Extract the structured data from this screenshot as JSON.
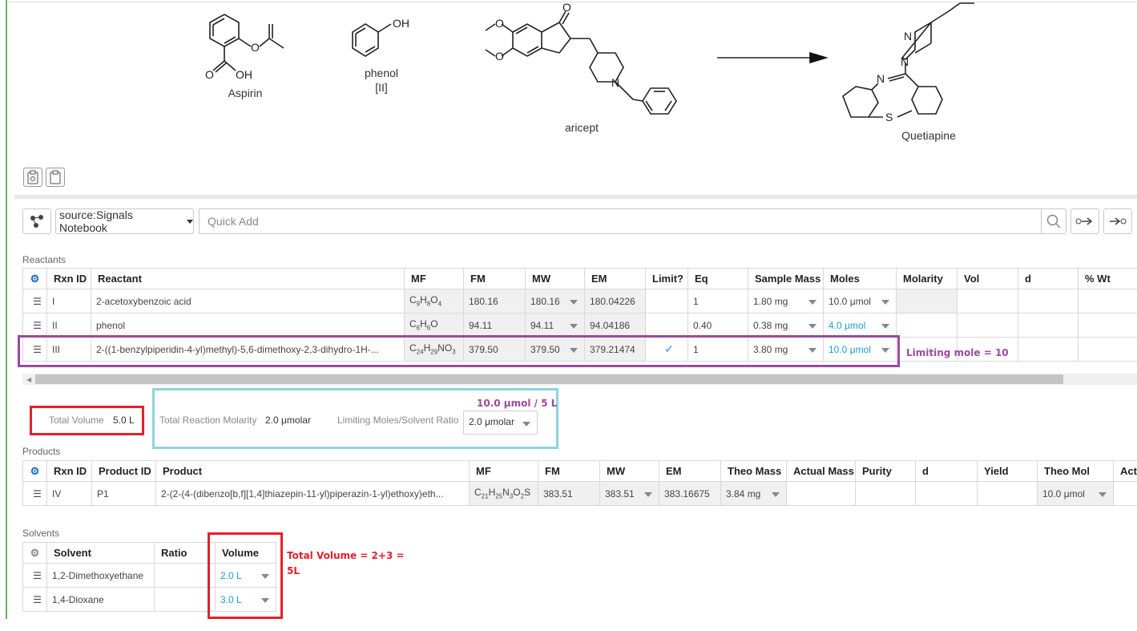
{
  "scheme": {
    "molecules": [
      {
        "label": "Aspirin",
        "atoms": [
          "O",
          "OH",
          "O"
        ]
      },
      {
        "label": "phenol",
        "sublabel": "[II]",
        "atoms": [
          "OH"
        ]
      },
      {
        "label": "aricept",
        "atoms": [
          "O",
          "N"
        ]
      },
      {
        "label": "Quetiapine",
        "atoms": [
          "N",
          "N",
          "N",
          "S"
        ]
      }
    ]
  },
  "toolbar": {
    "source_label": "source:Signals Notebook",
    "quick_add_placeholder": "Quick Add"
  },
  "reactants": {
    "section_label": "Reactants",
    "columns": [
      "Rxn ID",
      "Reactant",
      "MF",
      "FM",
      "MW",
      "EM",
      "Limit?",
      "Eq",
      "Sample Mass",
      "Moles",
      "Molarity",
      "Vol",
      "d",
      "% Wt"
    ],
    "rows": [
      {
        "rxn_id": "I",
        "reactant": "2-acetoxybenzoic acid",
        "mf": [
          "C",
          "9",
          "H",
          "8",
          "O",
          "4"
        ],
        "fm": "180.16",
        "mw": "180.16",
        "em": "180.04226",
        "limit": "",
        "eq": "1",
        "sample_mass": "1.80 mg",
        "moles": "10.0 μmol"
      },
      {
        "rxn_id": "II",
        "reactant": "phenol",
        "mf": [
          "C",
          "6",
          "H",
          "6",
          "O",
          ""
        ],
        "fm": "94.11",
        "mw": "94.11",
        "em": "94.04186",
        "limit": "",
        "eq": "0.40",
        "sample_mass": "0.38 mg",
        "moles": "4.0 μmol"
      },
      {
        "rxn_id": "III",
        "reactant": "2-((1-benzylpiperidin-4-yl)methyl)-5,6-dimethoxy-2,3-dihydro-1H-...",
        "mf": [
          "C",
          "24",
          "H",
          "29",
          "NO",
          "3"
        ],
        "fm": "379.50",
        "mw": "379.50",
        "em": "379.21474",
        "limit": "✓",
        "eq": "1",
        "sample_mass": "3.80 mg",
        "moles": "10.0 μmol"
      }
    ]
  },
  "summary": {
    "total_volume_label": "Total Volume",
    "total_volume_value": "5.0 L",
    "total_molarity_label": "Total Reaction Molarity",
    "total_molarity_value": "2.0 μmolar",
    "limiting_ratio_label": "Limiting Moles/Solvent Ratio",
    "limiting_ratio_value": "2.0 μmolar"
  },
  "products": {
    "section_label": "Products",
    "columns": [
      "Rxn ID",
      "Product ID",
      "Product",
      "MF",
      "FM",
      "MW",
      "EM",
      "Theo Mass",
      "Actual Mass",
      "Purity",
      "d",
      "Yield",
      "Theo Mol",
      "Actu"
    ],
    "rows": [
      {
        "rxn_id": "IV",
        "product_id": "P1",
        "product": "2-(2-(4-(dibenzo[b,f][1,4]thiazepin-11-yl)piperazin-1-yl)ethoxy)eth...",
        "mf": [
          "C",
          "21",
          "H",
          "25",
          "N",
          "3",
          "O",
          "2",
          "S",
          ""
        ],
        "fm": "383.51",
        "mw": "383.51",
        "em": "383.16675",
        "theo_mass": "3.84 mg",
        "theo_mol": "10.0 μmol"
      }
    ]
  },
  "solvents": {
    "section_label": "Solvents",
    "columns": [
      "Solvent",
      "Ratio",
      "Volume"
    ],
    "rows": [
      {
        "solvent": "1,2-Dimethoxyethane",
        "ratio": "",
        "volume": "2.0 L"
      },
      {
        "solvent": "1,4-Dioxane",
        "ratio": "",
        "volume": "3.0 L"
      }
    ]
  },
  "annotations": {
    "limiting_mole": "Limiting mole = 10",
    "ratio_note": "10.0 μmol / 5 L",
    "total_volume_note_line1": "Total Volume = 2+3 =",
    "total_volume_note_line2": "5L",
    "colors": {
      "purple": "#9b4a9e",
      "red": "#e4202a",
      "cyan": "#8ed3df"
    }
  },
  "icons": [
    "clipboard-settings-icon",
    "clipboard-icon",
    "molecule-tools-icon",
    "search-icon",
    "add-reactant-arrow-icon",
    "add-product-arrow-icon",
    "gear-icon",
    "drag-handle-icon",
    "dropdown-caret-icon",
    "check-icon"
  ]
}
